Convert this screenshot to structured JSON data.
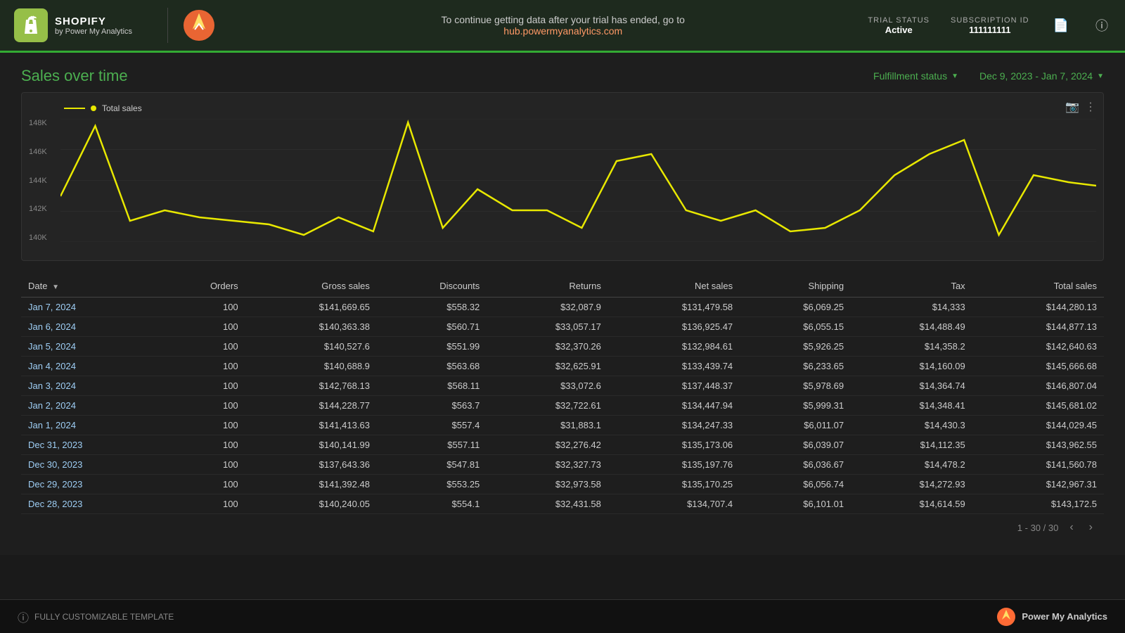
{
  "header": {
    "shopify_title": "SHOPIFY",
    "shopify_sub": "by Power My Analytics",
    "trial_message": "To continue getting data after your trial has ended, go to",
    "trial_link": "hub.powermyanalytics.com",
    "trial_status_label": "TRIAL STATUS",
    "trial_status_value": "Active",
    "subscription_label": "SUBSCRIPTION ID",
    "subscription_value": "111111111"
  },
  "chart_section": {
    "title": "Sales over time",
    "filter_label": "Fulfillment status",
    "date_range": "Dec 9, 2023 - Jan 7, 2024",
    "legend_label": "Total sales",
    "y_labels": [
      "148K",
      "146K",
      "144K",
      "142K",
      "140K"
    ]
  },
  "table": {
    "columns": [
      "Date",
      "Orders",
      "Gross sales",
      "Discounts",
      "Returns",
      "Net sales",
      "Shipping",
      "Tax",
      "Total sales"
    ],
    "rows": [
      {
        "date": "Jan 7, 2024",
        "orders": "100",
        "gross": "$141,669.65",
        "discounts": "$558.32",
        "returns": "$32,087.9",
        "net": "$131,479.58",
        "shipping": "$6,069.25",
        "tax": "$14,333",
        "total": "$144,280.13"
      },
      {
        "date": "Jan 6, 2024",
        "orders": "100",
        "gross": "$140,363.38",
        "discounts": "$560.71",
        "returns": "$33,057.17",
        "net": "$136,925.47",
        "shipping": "$6,055.15",
        "tax": "$14,488.49",
        "total": "$144,877.13"
      },
      {
        "date": "Jan 5, 2024",
        "orders": "100",
        "gross": "$140,527.6",
        "discounts": "$551.99",
        "returns": "$32,370.26",
        "net": "$132,984.61",
        "shipping": "$5,926.25",
        "tax": "$14,358.2",
        "total": "$142,640.63"
      },
      {
        "date": "Jan 4, 2024",
        "orders": "100",
        "gross": "$140,688.9",
        "discounts": "$563.68",
        "returns": "$32,625.91",
        "net": "$133,439.74",
        "shipping": "$6,233.65",
        "tax": "$14,160.09",
        "total": "$145,666.68"
      },
      {
        "date": "Jan 3, 2024",
        "orders": "100",
        "gross": "$142,768.13",
        "discounts": "$568.11",
        "returns": "$33,072.6",
        "net": "$137,448.37",
        "shipping": "$5,978.69",
        "tax": "$14,364.74",
        "total": "$146,807.04"
      },
      {
        "date": "Jan 2, 2024",
        "orders": "100",
        "gross": "$144,228.77",
        "discounts": "$563.7",
        "returns": "$32,722.61",
        "net": "$134,447.94",
        "shipping": "$5,999.31",
        "tax": "$14,348.41",
        "total": "$145,681.02"
      },
      {
        "date": "Jan 1, 2024",
        "orders": "100",
        "gross": "$141,413.63",
        "discounts": "$557.4",
        "returns": "$31,883.1",
        "net": "$134,247.33",
        "shipping": "$6,011.07",
        "tax": "$14,430.3",
        "total": "$144,029.45"
      },
      {
        "date": "Dec 31, 2023",
        "orders": "100",
        "gross": "$140,141.99",
        "discounts": "$557.11",
        "returns": "$32,276.42",
        "net": "$135,173.06",
        "shipping": "$6,039.07",
        "tax": "$14,112.35",
        "total": "$143,962.55"
      },
      {
        "date": "Dec 30, 2023",
        "orders": "100",
        "gross": "$137,643.36",
        "discounts": "$547.81",
        "returns": "$32,327.73",
        "net": "$135,197.76",
        "shipping": "$6,036.67",
        "tax": "$14,478.2",
        "total": "$141,560.78"
      },
      {
        "date": "Dec 29, 2023",
        "orders": "100",
        "gross": "$141,392.48",
        "discounts": "$553.25",
        "returns": "$32,973.58",
        "net": "$135,170.25",
        "shipping": "$6,056.74",
        "tax": "$14,272.93",
        "total": "$142,967.31"
      },
      {
        "date": "Dec 28, 2023",
        "orders": "100",
        "gross": "$140,240.05",
        "discounts": "$554.1",
        "returns": "$32,431.58",
        "net": "$134,707.4",
        "shipping": "$6,101.01",
        "tax": "$14,614.59",
        "total": "$143,172.5"
      }
    ],
    "pagination": "1 - 30 / 30"
  },
  "footer": {
    "customize_label": "FULLY CUSTOMIZABLE TEMPLATE",
    "brand_label": "Power My Analytics"
  }
}
